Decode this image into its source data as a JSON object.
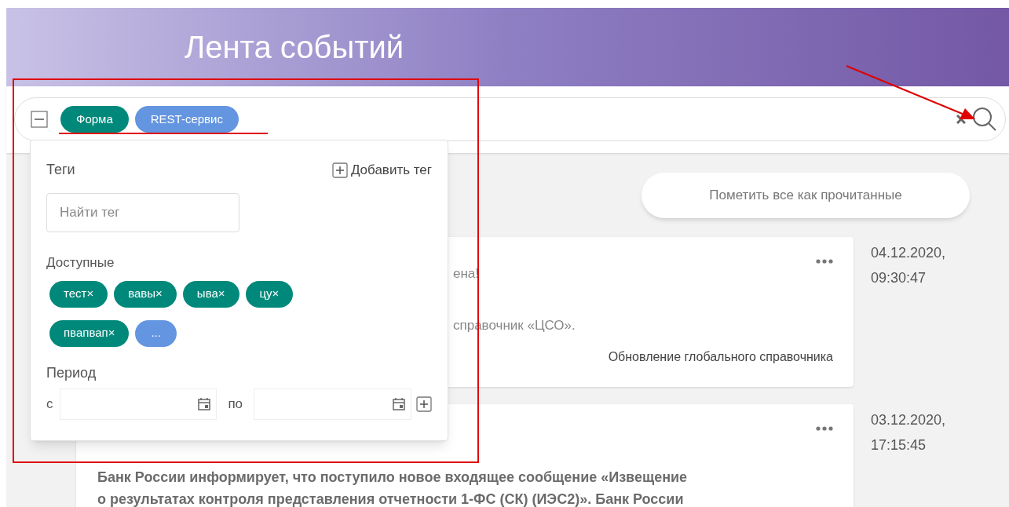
{
  "header": {
    "title": "Лента событий"
  },
  "search": {
    "selected_tags": [
      {
        "label": "Форма",
        "color": "#00897b"
      },
      {
        "label": "REST-сервис",
        "color": "#6495e0"
      }
    ]
  },
  "filter_panel": {
    "tags_label": "Теги",
    "add_tag": "Добавить тег",
    "tag_search": {
      "placeholder": "Найти тег"
    },
    "available_label": "Доступные",
    "available_tags": [
      {
        "label": "тест×",
        "kind": "tag"
      },
      {
        "label": "вавы×",
        "kind": "tag"
      },
      {
        "label": "ыва×",
        "kind": "tag"
      },
      {
        "label": "цу×",
        "kind": "tag"
      },
      {
        "label": "пвапвап×",
        "kind": "tag"
      },
      {
        "label": "...",
        "kind": "more"
      }
    ],
    "period_label": "Период",
    "from_label": "с",
    "to_label": "по"
  },
  "mark_all_read": "Пометить все как прочитанные",
  "events": [
    {
      "lines": [
        "ена!",
        "справочник «ЦСО»."
      ],
      "footer": "Обновление глобального справочника",
      "bold": false,
      "date": "04.12.2020,",
      "time": "09:30:47"
    },
    {
      "lines": [
        "Банк России информирует, что поступило новое входящее сообщение «Извещение",
        "о результатах контроля представления отчетности 1-ФС (СК) (ИЭС2)». Банк России"
      ],
      "bold": true,
      "date": "03.12.2020,",
      "time": "17:15:45"
    }
  ]
}
